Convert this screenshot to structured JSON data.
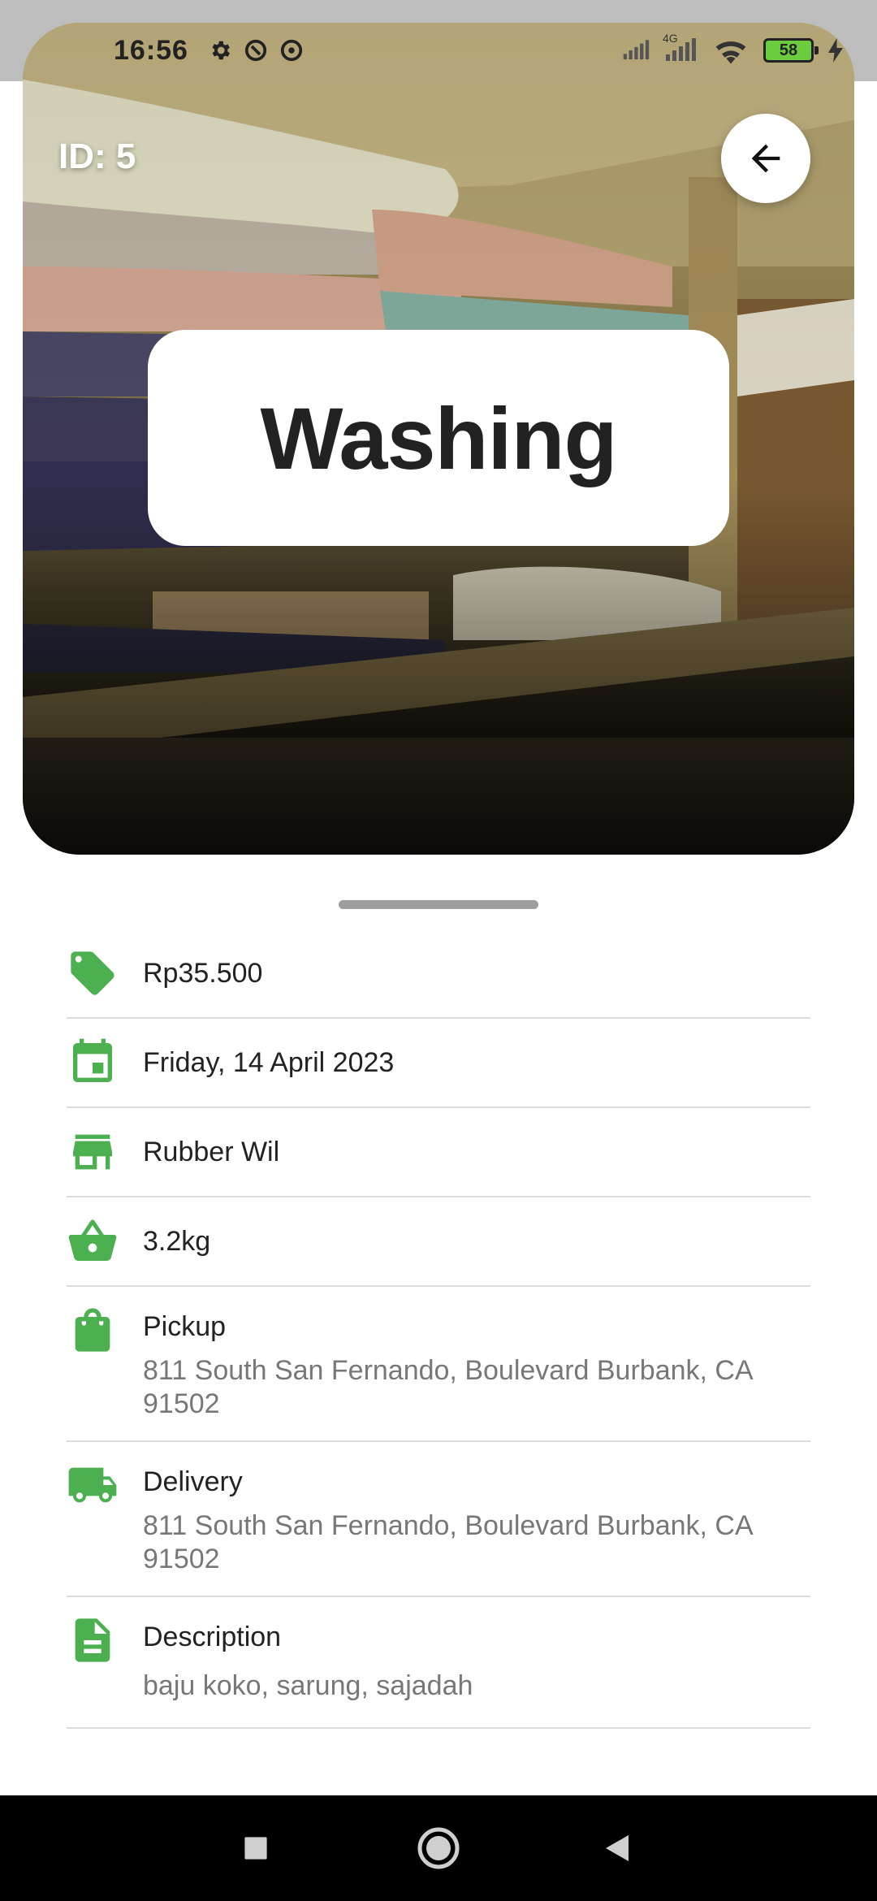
{
  "status_bar": {
    "time": "16:56",
    "network": "4G",
    "battery_level": "58"
  },
  "hero": {
    "id_label": "ID: 5",
    "title": "Washing"
  },
  "details": {
    "price": "Rp35.500",
    "date": "Friday, 14 April 2023",
    "store": "Rubber Wil",
    "weight": "3.2kg",
    "pickup": {
      "label": "Pickup",
      "address": "811 South San Fernando, Boulevard Burbank, CA 91502"
    },
    "delivery": {
      "label": "Delivery",
      "address": "811 South San Fernando, Boulevard Burbank, CA 91502"
    },
    "description": {
      "label": "Description",
      "text": "baju koko, sarung, sajadah"
    }
  },
  "icons": {
    "price": "tag-icon",
    "date": "calendar-icon",
    "store": "store-icon",
    "weight": "basket-icon",
    "pickup": "shopping-bag-icon",
    "delivery": "truck-icon",
    "description": "document-icon",
    "back": "arrow-left-icon"
  },
  "colors": {
    "accent": "#4caf50",
    "title_card": "#ffffff",
    "nav_bar": "#000000"
  }
}
